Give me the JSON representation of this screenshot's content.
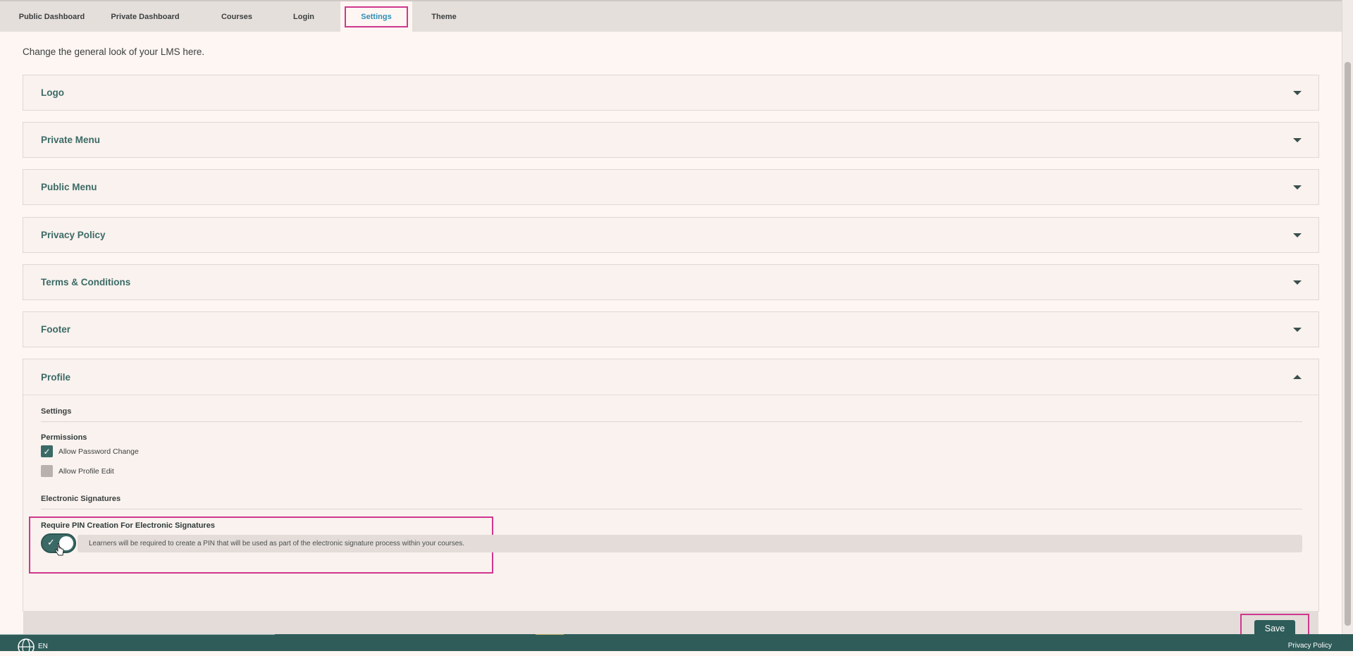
{
  "nav": {
    "tabs": [
      {
        "label": "Public Dashboard"
      },
      {
        "label": "Private Dashboard"
      },
      {
        "label": "Courses"
      },
      {
        "label": "Login"
      },
      {
        "label": "Settings"
      },
      {
        "label": "Theme"
      }
    ],
    "active": "Settings"
  },
  "intro": "Change the general look of your LMS here.",
  "panels": [
    {
      "title": "Logo"
    },
    {
      "title": "Private Menu"
    },
    {
      "title": "Public Menu"
    },
    {
      "title": "Privacy Policy"
    },
    {
      "title": "Terms & Conditions"
    },
    {
      "title": "Footer"
    }
  ],
  "profile": {
    "title": "Profile",
    "settings_label": "Settings",
    "permissions_label": "Permissions",
    "permissions": [
      {
        "label": "Allow Password Change",
        "checked": true
      },
      {
        "label": "Allow Profile Edit",
        "checked": false
      }
    ],
    "esign_label": "Electronic Signatures",
    "pin_title": "Require PIN Creation For Electronic Signatures",
    "pin_description": "Learners will be required to create a PIN that will be used as part of the electronic signature process within your courses.",
    "pin_enabled": true,
    "save_label": "Save"
  },
  "footer": {
    "lang": "EN",
    "privacy_link": "Privacy Policy"
  },
  "colors": {
    "accent": "#3b6a66",
    "highlight": "#d0378e",
    "active_tab_text": "#2f8fb5"
  }
}
